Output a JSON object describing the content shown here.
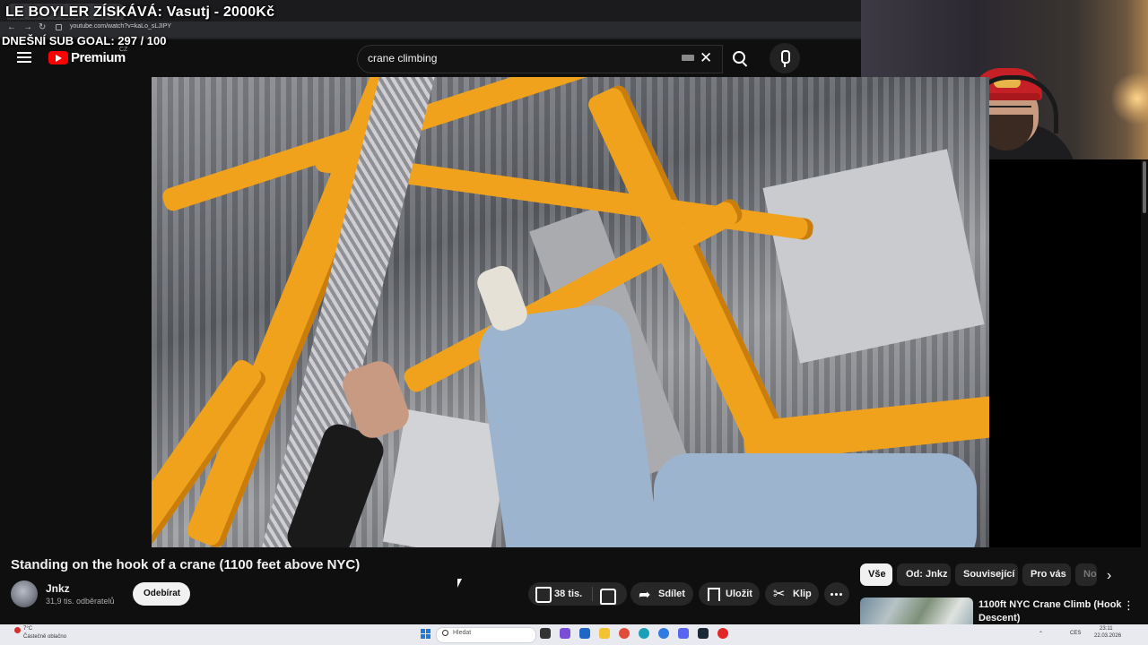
{
  "stream_overlay": {
    "title": "LE BOYLER ZÍSKÁVÁ: Vasutj - 2000Kč",
    "sub_goal": "DNEŠNÍ SUB GOAL:  297 / 100"
  },
  "browser": {
    "url": "youtube.com/watch?v=kaLo_sLJIPY"
  },
  "masthead": {
    "logo_label": "Premium",
    "country_code": "CZ",
    "search_value": "crane climbing"
  },
  "video": {
    "title": "Standing on the hook of a crane (1100 feet above NYC)",
    "channel": "Jnkz",
    "subscribers": "31,9 tis. odběratelů",
    "subscribe_label": "Odebírat",
    "likes": "38 tis.",
    "share_label": "Sdílet",
    "save_label": "Uložit",
    "clip_label": "Klip"
  },
  "chips": [
    {
      "label": "Vše",
      "active": true
    },
    {
      "label": "Od: Jnkz",
      "active": false
    },
    {
      "label": "Související",
      "active": false
    },
    {
      "label": "Pro vás",
      "active": false
    },
    {
      "label": "No",
      "active": false
    }
  ],
  "recommended": [
    {
      "title": "1100ft NYC Crane Climb (Hook Descent)"
    }
  ],
  "taskbar": {
    "weather_temp": "7°C",
    "weather_desc": "Částečně oblačno",
    "search_placeholder": "Hledat",
    "language": "CES",
    "time": "23:11",
    "date": "22.03.2026"
  },
  "colors": {
    "bg": "#0f0f0f",
    "brand_red": "#ff0000",
    "crane_yellow": "#f0a21c"
  }
}
